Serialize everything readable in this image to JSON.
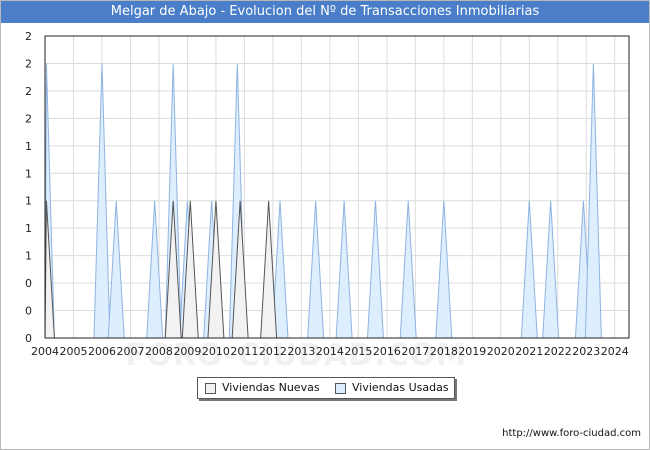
{
  "title": "Melgar de Abajo - Evolucion del Nº de Transacciones Inmobiliarias",
  "footer_url": "http://www.foro-ciudad.com",
  "watermark": "FORO-CIUDAD.COM",
  "colors": {
    "title_bg": "#4a7ec8",
    "nuevas": "#f2f2f2",
    "usadas": "#ddeeff",
    "usadas_line": "#8fb3e0"
  },
  "chart_data": {
    "type": "area",
    "title": "Melgar de Abajo - Evolucion del Nº de Transacciones Inmobiliarias",
    "xlabel": "",
    "ylabel": "",
    "xlim": [
      2004,
      2024.5
    ],
    "ylim": [
      0,
      2.2
    ],
    "y_tick_labels": [
      "0",
      "0",
      "0",
      "1",
      "1",
      "1",
      "1",
      "1",
      "2",
      "2",
      "2",
      "2"
    ],
    "x_tick_labels": [
      "2004",
      "2005",
      "2006",
      "2007",
      "2008",
      "2009",
      "2010",
      "2011",
      "2012",
      "2013",
      "2014",
      "2015",
      "2016",
      "2017",
      "2018",
      "2019",
      "2020",
      "2021",
      "2022",
      "2023",
      "2024"
    ],
    "grid": true,
    "legend_position": "bottom",
    "series": [
      {
        "name": "Viviendas Nuevas",
        "color": "#f2f2f2",
        "peaks": [
          {
            "x": 2004.05,
            "y": 1.0
          },
          {
            "x": 2008.5,
            "y": 1.0
          },
          {
            "x": 2009.1,
            "y": 1.0
          },
          {
            "x": 2010.0,
            "y": 1.0
          },
          {
            "x": 2010.85,
            "y": 1.0
          },
          {
            "x": 2011.85,
            "y": 1.0
          }
        ]
      },
      {
        "name": "Viviendas Usadas",
        "color": "#ddeeff",
        "peaks": [
          {
            "x": 2004.05,
            "y": 2.0
          },
          {
            "x": 2006.0,
            "y": 2.0
          },
          {
            "x": 2006.5,
            "y": 1.0
          },
          {
            "x": 2007.85,
            "y": 1.0
          },
          {
            "x": 2008.5,
            "y": 2.0
          },
          {
            "x": 2009.0,
            "y": 1.0
          },
          {
            "x": 2009.85,
            "y": 1.0
          },
          {
            "x": 2010.75,
            "y": 2.0
          },
          {
            "x": 2012.25,
            "y": 1.0
          },
          {
            "x": 2013.5,
            "y": 1.0
          },
          {
            "x": 2014.5,
            "y": 1.0
          },
          {
            "x": 2015.6,
            "y": 1.0
          },
          {
            "x": 2016.75,
            "y": 1.0
          },
          {
            "x": 2018.0,
            "y": 1.0
          },
          {
            "x": 2021.0,
            "y": 1.0
          },
          {
            "x": 2021.75,
            "y": 1.0
          },
          {
            "x": 2022.9,
            "y": 1.0
          },
          {
            "x": 2023.25,
            "y": 2.0
          }
        ]
      }
    ]
  }
}
